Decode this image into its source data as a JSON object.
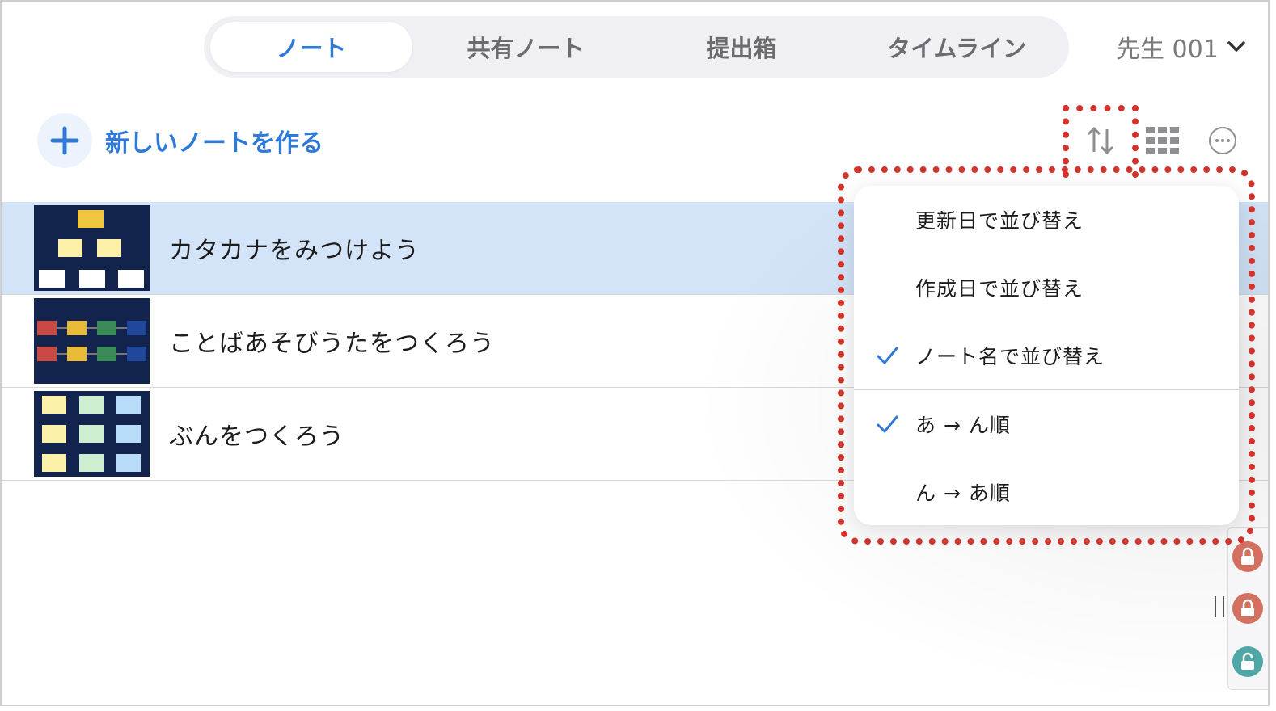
{
  "tabs": [
    {
      "label": "ノート",
      "active": true
    },
    {
      "label": "共有ノート",
      "active": false
    },
    {
      "label": "提出箱",
      "active": false
    },
    {
      "label": "タイムライン",
      "active": false
    }
  ],
  "user": {
    "name": "先生 001"
  },
  "create_note": {
    "label": "新しいノートを作る"
  },
  "toolbar": {
    "sort": "sort-icon",
    "grid": "grid-view-icon",
    "more": "more-icon"
  },
  "notes": [
    {
      "title": "カタカナをみつけよう",
      "selected": true
    },
    {
      "title": "ことばあそびうたをつくろう",
      "selected": false
    },
    {
      "title": "ぶんをつくろう",
      "selected": false
    }
  ],
  "sort_menu": {
    "sort_by": [
      {
        "label": "更新日で並び替え",
        "checked": false
      },
      {
        "label": "作成日で並び替え",
        "checked": false
      },
      {
        "label": "ノート名で並び替え",
        "checked": true
      }
    ],
    "order": [
      {
        "label": "あ → ん順",
        "checked": true
      },
      {
        "label": "ん → あ順",
        "checked": false
      }
    ]
  },
  "colors": {
    "accent": "#2f7ad9",
    "selected_row": "#d3e4f9",
    "annotation": "#d0342c"
  }
}
